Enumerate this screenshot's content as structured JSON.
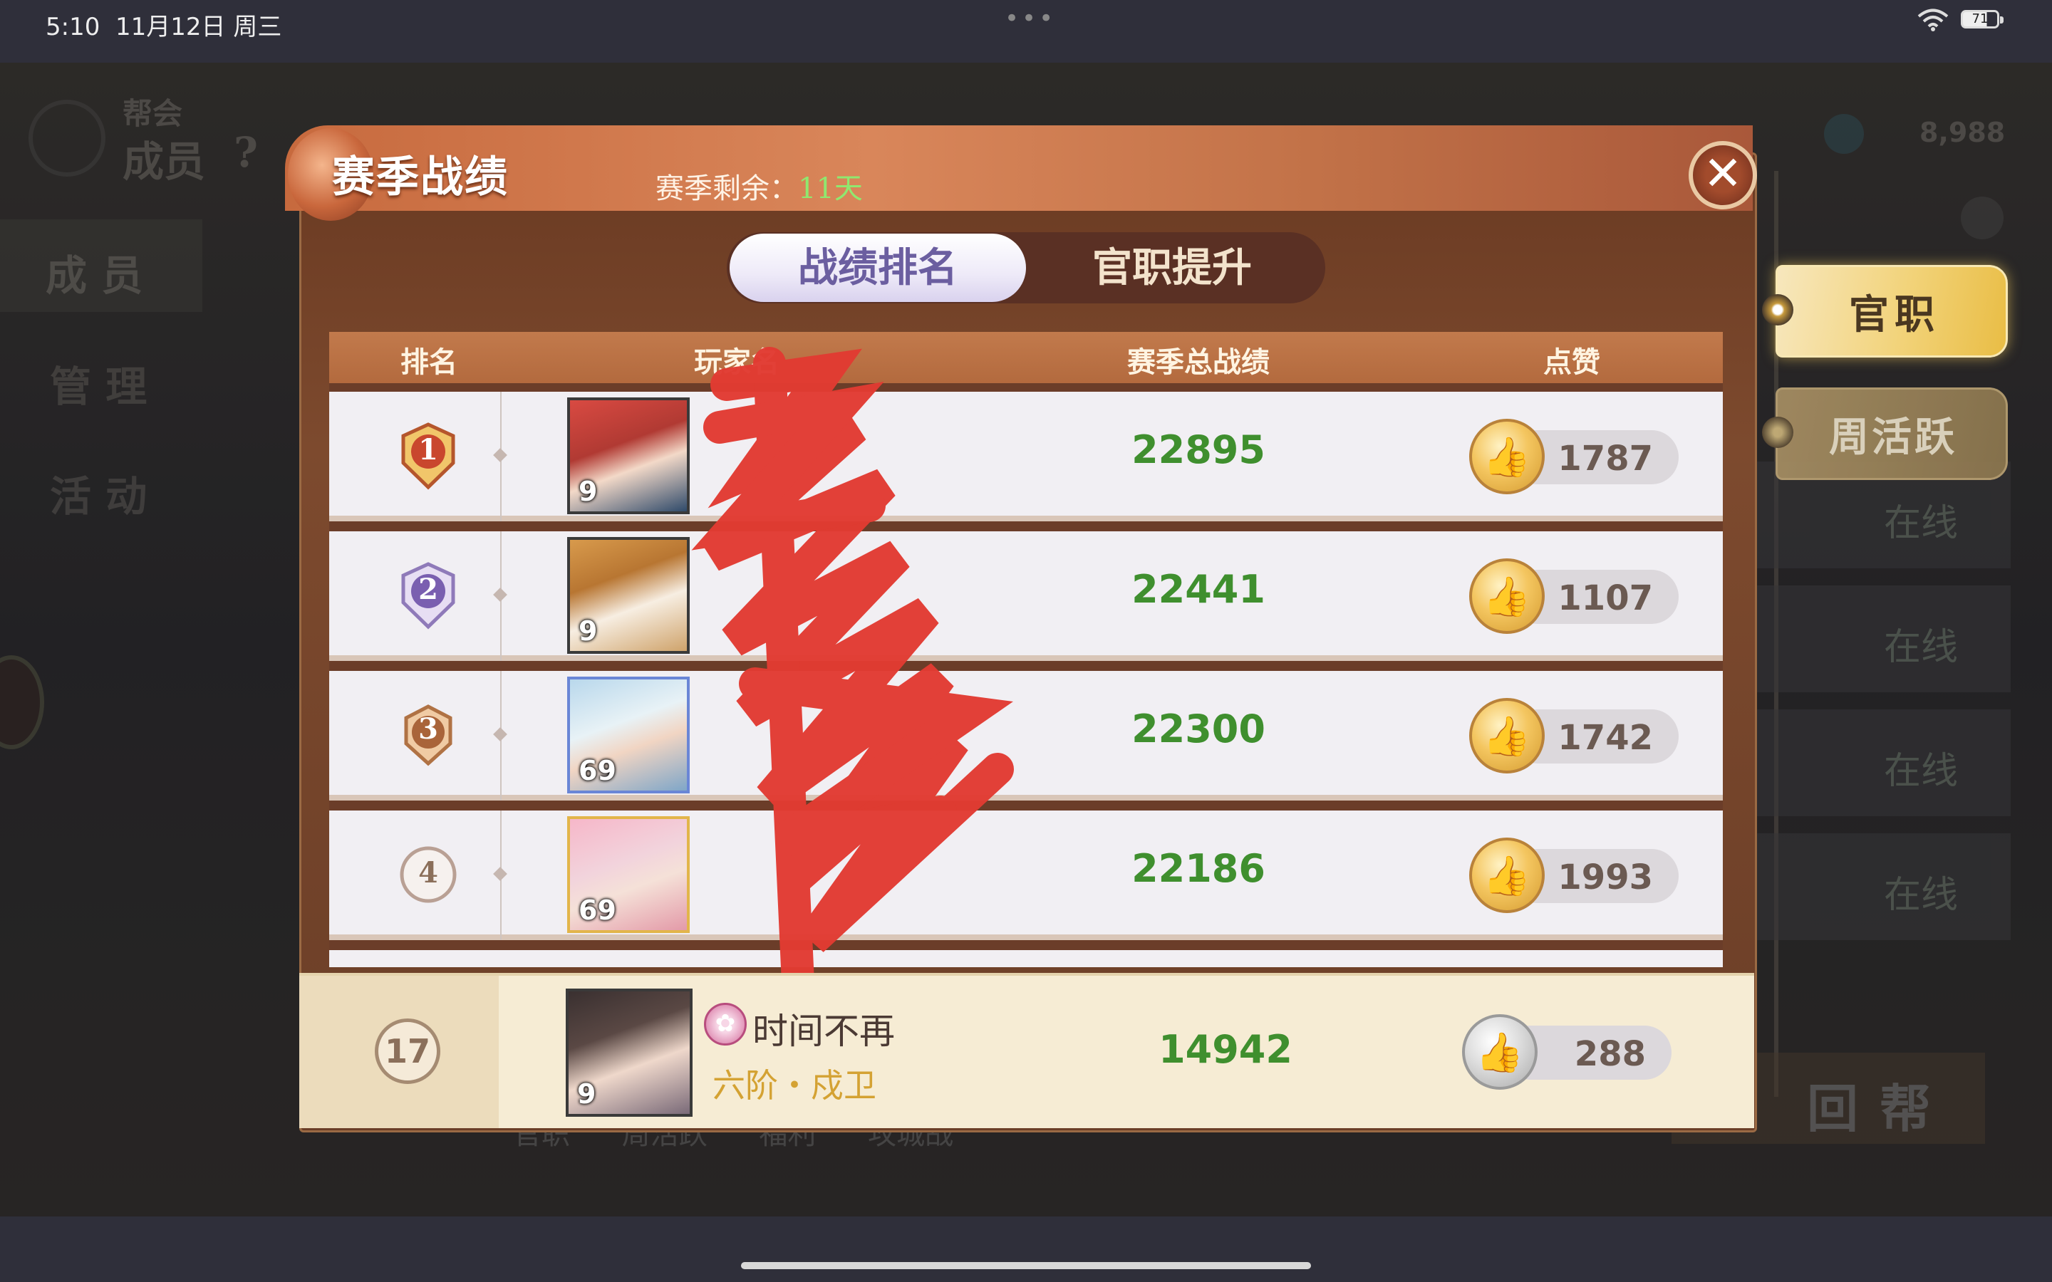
{
  "status_bar": {
    "time": "5:10",
    "date": "11月12日 周三",
    "battery": "71"
  },
  "background": {
    "guild_label": "帮会",
    "members_label": "成员",
    "help_mark": "?",
    "nav_members": "成 员",
    "nav_manage": "管 理",
    "nav_activity": "活 动",
    "currency_value": "8,988",
    "online_rows": [
      "在线",
      "在线",
      "在线",
      "在线"
    ],
    "return_label": "回帮",
    "bottom_tabs": "官职 周活跃 福利 攻城战"
  },
  "side_buttons": {
    "guanzhi": "官职",
    "huoyue": "周活跃"
  },
  "modal": {
    "title": "赛季战绩",
    "season_remaining_label": "赛季剩余：",
    "season_remaining_value": "11天",
    "tabs": {
      "ranking": "战绩排名",
      "promotion": "官职提升"
    },
    "columns": {
      "rank": "排名",
      "player": "玩家名",
      "score": "赛季总战绩",
      "likes": "点赞"
    },
    "rows": [
      {
        "rank": "1",
        "level": "9",
        "score": "22895",
        "likes": "1787"
      },
      {
        "rank": "2",
        "level": "9",
        "score": "22441",
        "likes": "1107"
      },
      {
        "rank": "3",
        "level": "69",
        "score": "22300",
        "likes": "1742"
      },
      {
        "rank": "4",
        "level": "69",
        "score": "22186",
        "likes": "1993"
      }
    ],
    "self_row": {
      "rank": "17",
      "level": "9",
      "name": "时间不再",
      "title": "六阶・戍卫",
      "score": "14942",
      "likes": "288"
    }
  },
  "colors": {
    "score_green": "#3f8f2e",
    "header_orange": "#b36a3e",
    "gold": "#f2d37a",
    "redaction_red": "#e23b32"
  }
}
